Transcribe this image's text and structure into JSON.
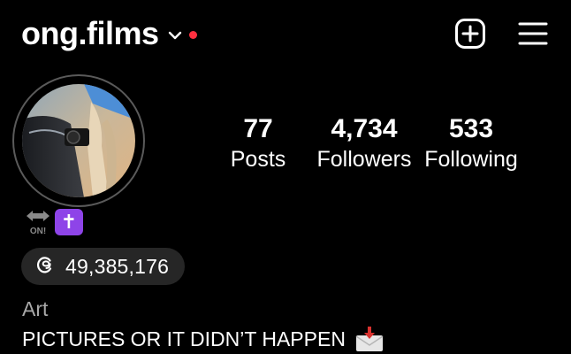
{
  "header": {
    "username": "ong.films",
    "icons": {
      "dropdown": "chevron-down-icon",
      "notification": "red-dot-indicator",
      "new_post": "plus-square-icon",
      "menu": "hamburger-menu-icon"
    },
    "notification_color": "#ff3040"
  },
  "profile": {
    "avatar": "profile-photo",
    "stats": [
      {
        "value": "77",
        "label": "Posts"
      },
      {
        "value": "4,734",
        "label": "Followers"
      },
      {
        "value": "533",
        "label": "Following"
      }
    ],
    "badges": {
      "on_badge_text": "ON!",
      "cross_symbol": "✝",
      "cross_bg": "#8e44e8"
    },
    "threads": {
      "icon": "threads-icon",
      "count": "49,385,176"
    },
    "category": "Art",
    "bio": "PICTURES OR IT DIDN’T HAPPEN",
    "bio_icon": "envelope-with-arrow-icon"
  }
}
